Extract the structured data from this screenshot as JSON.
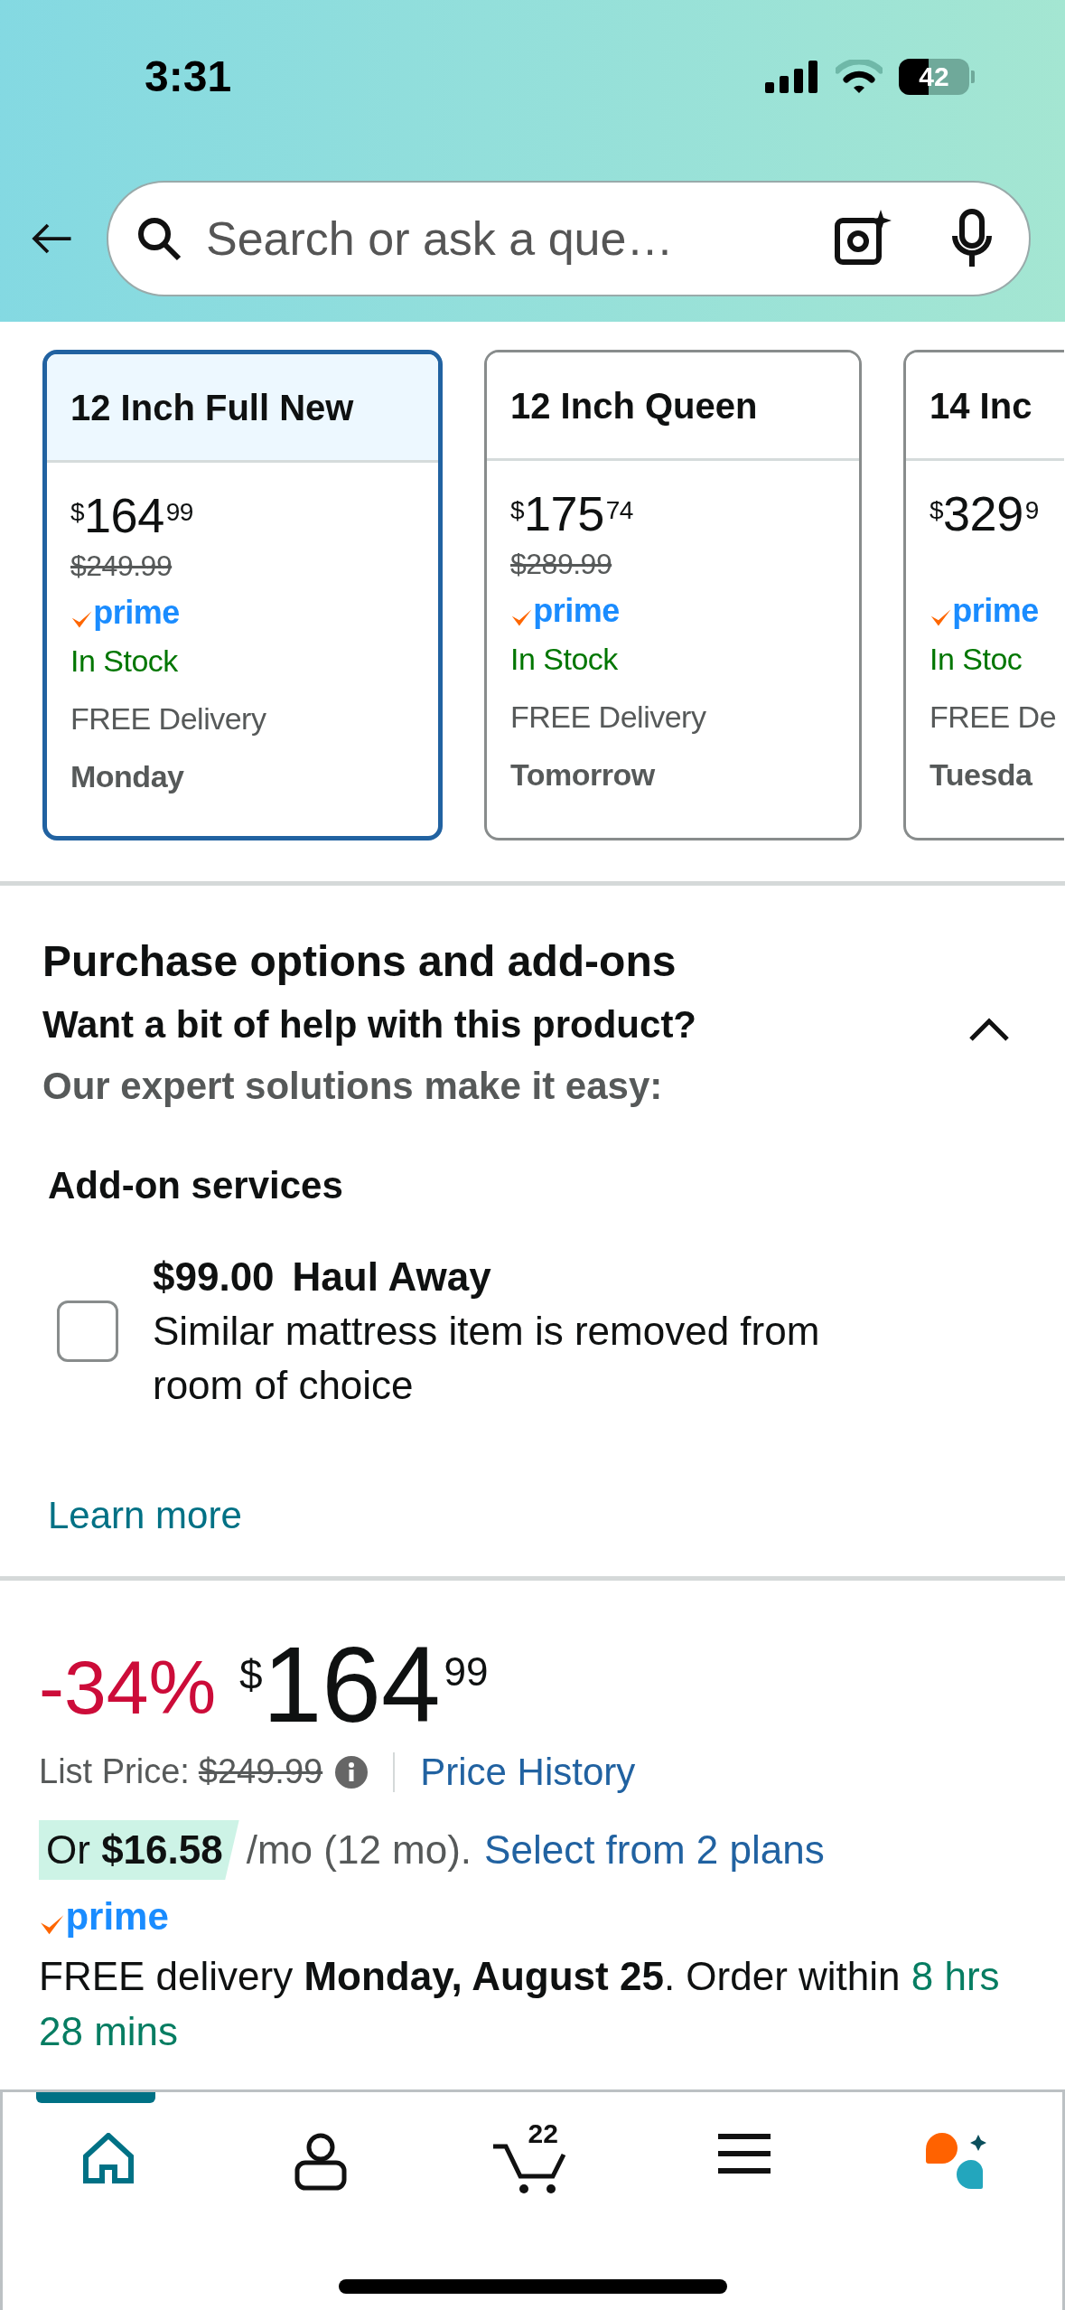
{
  "status_bar": {
    "time": "3:31",
    "battery": "42"
  },
  "search": {
    "placeholder": "Search or ask a que…"
  },
  "variants": [
    {
      "title": "12 Inch Full New",
      "currency": "$",
      "price_whole": "164",
      "price_fraction": "99",
      "list_price": "$249.99",
      "badge": "prime",
      "stock": "In Stock",
      "delivery": "FREE Delivery",
      "delivery_day": "Monday",
      "selected": true
    },
    {
      "title": "12 Inch Queen",
      "currency": "$",
      "price_whole": "175",
      "price_fraction": "74",
      "list_price": "$289.99",
      "badge": "prime",
      "stock": "In Stock",
      "delivery": "FREE Delivery",
      "delivery_day": "Tomorrow",
      "selected": false
    },
    {
      "title": "14 Inc",
      "currency": "$",
      "price_whole": "329",
      "price_fraction": "9",
      "badge": "prime",
      "stock": "In Stoc",
      "delivery": "FREE De",
      "delivery_day": "Tuesda",
      "selected": false
    }
  ],
  "purchase_options": {
    "title": "Purchase options and add-ons",
    "question": "Want a bit of help with this product?",
    "subtitle": "Our expert solutions make it easy:",
    "expanded": true,
    "section_label": "Add-on services",
    "addons": [
      {
        "price": "$99.00",
        "name": "Haul Away",
        "description": "Similar mattress item is removed from room of choice",
        "checked": false
      }
    ],
    "link": "Learn more"
  },
  "pricing": {
    "discount": "-34%",
    "currency": "$",
    "whole": "164",
    "fraction": "99",
    "list_price_label": "List Price:",
    "list_price": "$249.99",
    "history_link": "Price History",
    "installment_prefix": "Or",
    "installment_amount": "$16.58",
    "installment_suffix": "/mo (12 mo).",
    "plans_link": "Select from 2 plans",
    "badge": "prime",
    "delivery": "FREE delivery **Monday, August 25**. Order within",
    "countdown": "8 hrs 28 mins"
  },
  "nav": [
    {
      "kind": "home",
      "selected": true
    },
    {
      "kind": "account",
      "selected": false
    },
    {
      "kind": "cart",
      "count": "22",
      "selected": false
    },
    {
      "kind": "menu",
      "selected": false
    },
    {
      "kind": "assistant",
      "selected": false
    }
  ]
}
